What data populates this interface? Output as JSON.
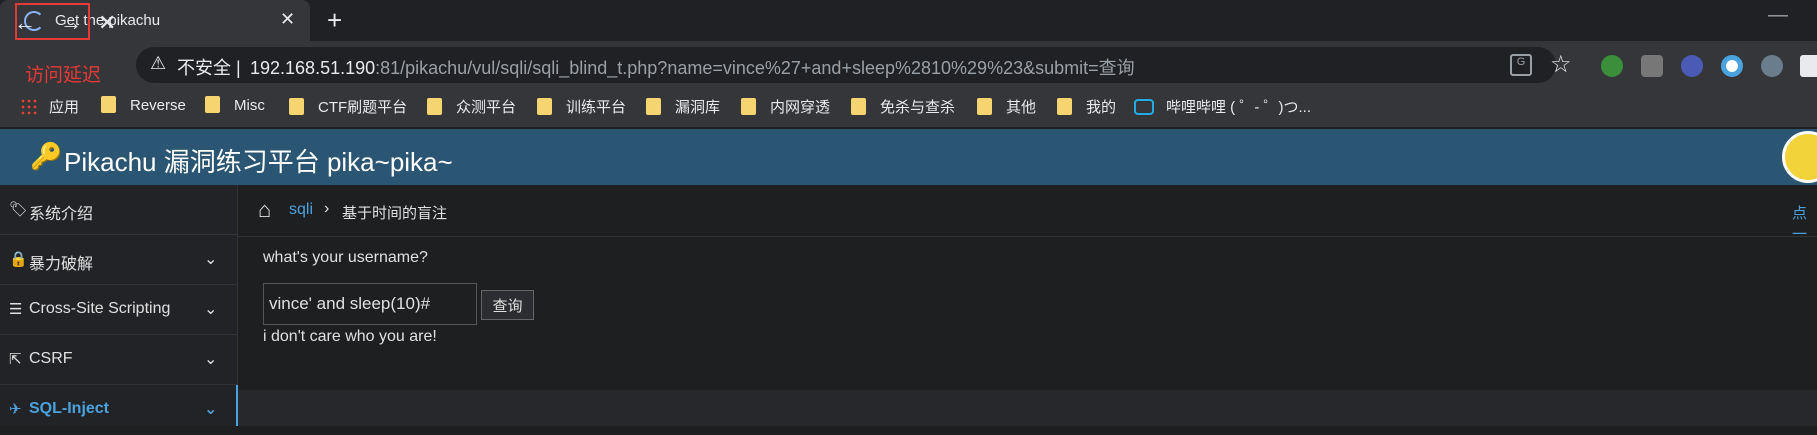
{
  "browser": {
    "tab_title": "Get the pikachu",
    "tab_close": "✕",
    "new_tab": "+",
    "minimize": "—",
    "nav_back": "←",
    "nav_forward": "→",
    "nav_stop": "✕",
    "overlay_annotation": "访问延迟",
    "address": {
      "security_label": "不安全",
      "separator": "|",
      "url_host": "192.168.51.190",
      "url_rest": ":81/pikachu/vul/sqli/sqli_blind_t.php?name=vince%27+and+sleep%2810%29%23&submit=查询"
    },
    "translate_label": "G",
    "star": "☆"
  },
  "bookmarks": [
    {
      "label": "应用",
      "icon": "apps-icon"
    },
    {
      "label": "Reverse",
      "icon": "folder-icon"
    },
    {
      "label": "Misc",
      "icon": "folder-icon"
    },
    {
      "label": "CTF刷题平台",
      "icon": "folder-icon"
    },
    {
      "label": "众测平台",
      "icon": "folder-icon"
    },
    {
      "label": "训练平台",
      "icon": "folder-icon"
    },
    {
      "label": "漏洞库",
      "icon": "folder-icon"
    },
    {
      "label": "内网穿透",
      "icon": "folder-icon"
    },
    {
      "label": "免杀与查杀",
      "icon": "folder-icon"
    },
    {
      "label": "其他",
      "icon": "folder-icon"
    },
    {
      "label": "我的",
      "icon": "folder-icon"
    },
    {
      "label": "哔哩哔哩 ( ゜- ゜)つ...",
      "icon": "bilibili-icon"
    }
  ],
  "header": {
    "title": "Pikachu 漏洞练习平台 pika~pika~"
  },
  "sidebar": {
    "items": [
      {
        "label": "系统介绍",
        "icon": "tags-icon",
        "chevron": ""
      },
      {
        "label": "暴力破解",
        "icon": "lock-icon",
        "chevron": "⌄"
      },
      {
        "label": "Cross-Site Scripting",
        "icon": "list-icon",
        "chevron": "⌄"
      },
      {
        "label": "CSRF",
        "icon": "share-icon",
        "chevron": "⌄"
      },
      {
        "label": "SQL-Inject",
        "icon": "plane-icon",
        "chevron": "⌄"
      }
    ]
  },
  "breadcrumb": {
    "link": "sqli",
    "separator": "›",
    "current": "基于时间的盲注",
    "right_text": "点一"
  },
  "form": {
    "question": "what's your username?",
    "input_value": "vince' and sleep(10)#",
    "submit_label": "查询",
    "result": "i don't care who you are!"
  },
  "colors": {
    "header_bg": "#2a5673",
    "accent": "#4aa3df",
    "annotation": "#e53935"
  }
}
